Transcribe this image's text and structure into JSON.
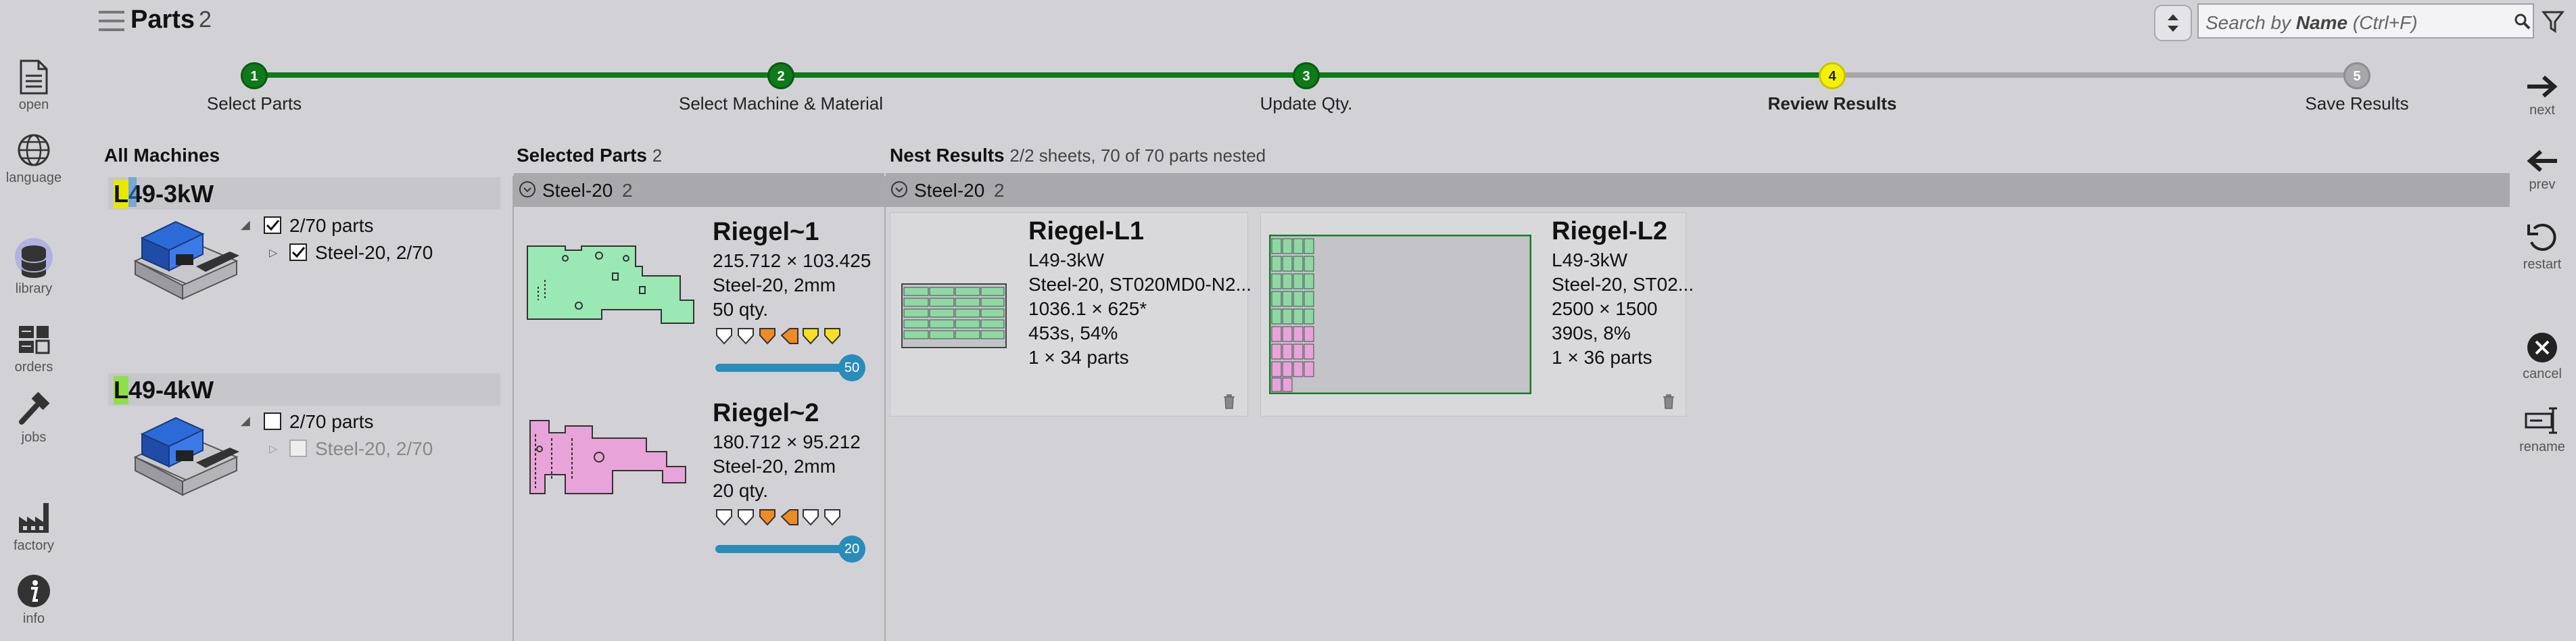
{
  "window": {
    "title": "Parts",
    "count": "2"
  },
  "search": {
    "placeholder_pre": "Search by ",
    "placeholder_bold": "Name",
    "placeholder_post": " (Ctrl+F)"
  },
  "left_rail": [
    {
      "id": "open",
      "label": "open"
    },
    {
      "id": "language",
      "label": "language"
    },
    {
      "id": "library",
      "label": "library",
      "active": true
    },
    {
      "id": "orders",
      "label": "orders"
    },
    {
      "id": "jobs",
      "label": "jobs"
    },
    {
      "id": "factory",
      "label": "factory"
    },
    {
      "id": "info",
      "label": "info"
    }
  ],
  "right_rail": [
    {
      "id": "next",
      "label": "next"
    },
    {
      "id": "prev",
      "label": "prev"
    },
    {
      "id": "restart",
      "label": "restart"
    },
    {
      "id": "cancel",
      "label": "cancel"
    },
    {
      "id": "rename",
      "label": "rename"
    }
  ],
  "steps": [
    {
      "num": "1",
      "label": "Select Parts",
      "state": "done"
    },
    {
      "num": "2",
      "label": "Select Machine & Material",
      "state": "done"
    },
    {
      "num": "3",
      "label": "Update Qty.",
      "state": "done"
    },
    {
      "num": "4",
      "label": "Review Results",
      "state": "current"
    },
    {
      "num": "5",
      "label": "Save Results",
      "state": "pending"
    }
  ],
  "colors": {
    "done": "#0f7a1a",
    "current": "#f5f00a",
    "pending": "#a8a8ac",
    "progress": "#2a8cb8"
  },
  "machines": {
    "header": "All Machines",
    "items": [
      {
        "name_hl": "L",
        "name_rest": "49-3kW",
        "parts": "2/70 parts",
        "checked": true,
        "material": "Steel-20, 2/70",
        "mat_checked": true
      },
      {
        "name_hl": "L",
        "name_rest": "49-4kW",
        "parts": "2/70 parts",
        "checked": false,
        "material": "Steel-20, 2/70",
        "mat_checked": false
      }
    ]
  },
  "selected_parts": {
    "header": "Selected Parts",
    "count": "2",
    "group": {
      "name": "Steel-20",
      "count": "2"
    },
    "items": [
      {
        "name": "Riegel~1",
        "dims": "215.712 × 103.425",
        "material": "Steel-20, 2mm",
        "qty": "50 qty.",
        "progress": 1.0,
        "progress_label": "50",
        "color": "#9ae8b4"
      },
      {
        "name": "Riegel~2",
        "dims": "180.712 × 95.212",
        "material": "Steel-20, 2mm",
        "qty": "20 qty.",
        "progress": 1.0,
        "progress_label": "20",
        "color": "#e8a4d8"
      }
    ]
  },
  "nest_results": {
    "header": "Nest Results",
    "summary": "2/2 sheets, 70 of 70 parts nested",
    "group": {
      "name": "Steel-20",
      "count": "2"
    },
    "items": [
      {
        "name": "Riegel-L1",
        "machine": "L49-3kW",
        "material": "Steel-20, ST020MD0-N2...",
        "sheet": "1036.1 × 625*",
        "time": "453s, 54%",
        "parts": "1 × 34 parts"
      },
      {
        "name": "Riegel-L2",
        "machine": "L49-3kW",
        "material": "Steel-20, ST02...",
        "sheet": "2500 × 1500",
        "time": "390s, 8%",
        "parts": "1 × 36 parts"
      }
    ]
  }
}
